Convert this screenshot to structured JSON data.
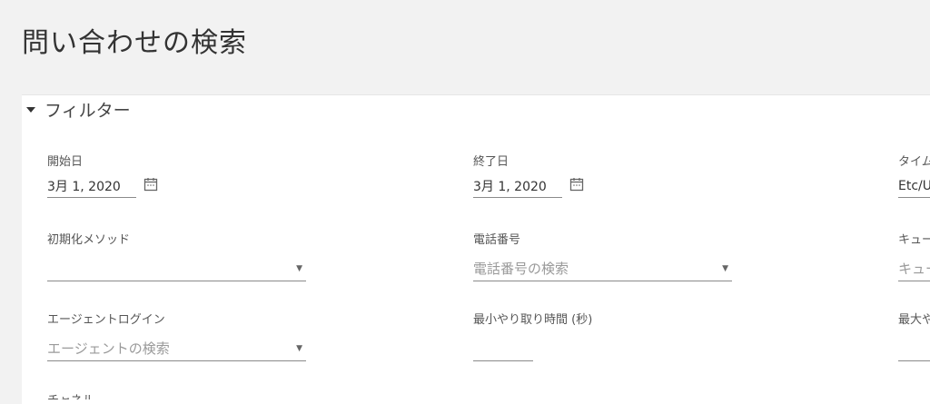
{
  "page": {
    "title": "問い合わせの検索"
  },
  "filter": {
    "header_label": "フィルター",
    "start_date": {
      "label": "開始日",
      "value": "3月 1, 2020"
    },
    "end_date": {
      "label": "終了日",
      "value": "3月 1, 2020"
    },
    "timezone": {
      "label": "タイム",
      "value": "Etc/U"
    },
    "init_method": {
      "label": "初期化メソッド",
      "placeholder": ""
    },
    "phone_number": {
      "label": "電話番号",
      "placeholder": "電話番号の検索"
    },
    "queue": {
      "label": "キュー",
      "placeholder": "キュー"
    },
    "agent_login": {
      "label": "エージェントログイン",
      "placeholder": "エージェントの検索"
    },
    "min_interaction_time": {
      "label": "最小やり取り時間 (秒)",
      "value": ""
    },
    "max_interaction_time": {
      "label": "最大や",
      "value": ""
    },
    "channel": {
      "label": "チャネル"
    }
  },
  "colors": {
    "background": "#f2f2f2",
    "panel": "#ffffff",
    "underline": "#8a8a8a",
    "placeholder": "#9a9a9a"
  }
}
